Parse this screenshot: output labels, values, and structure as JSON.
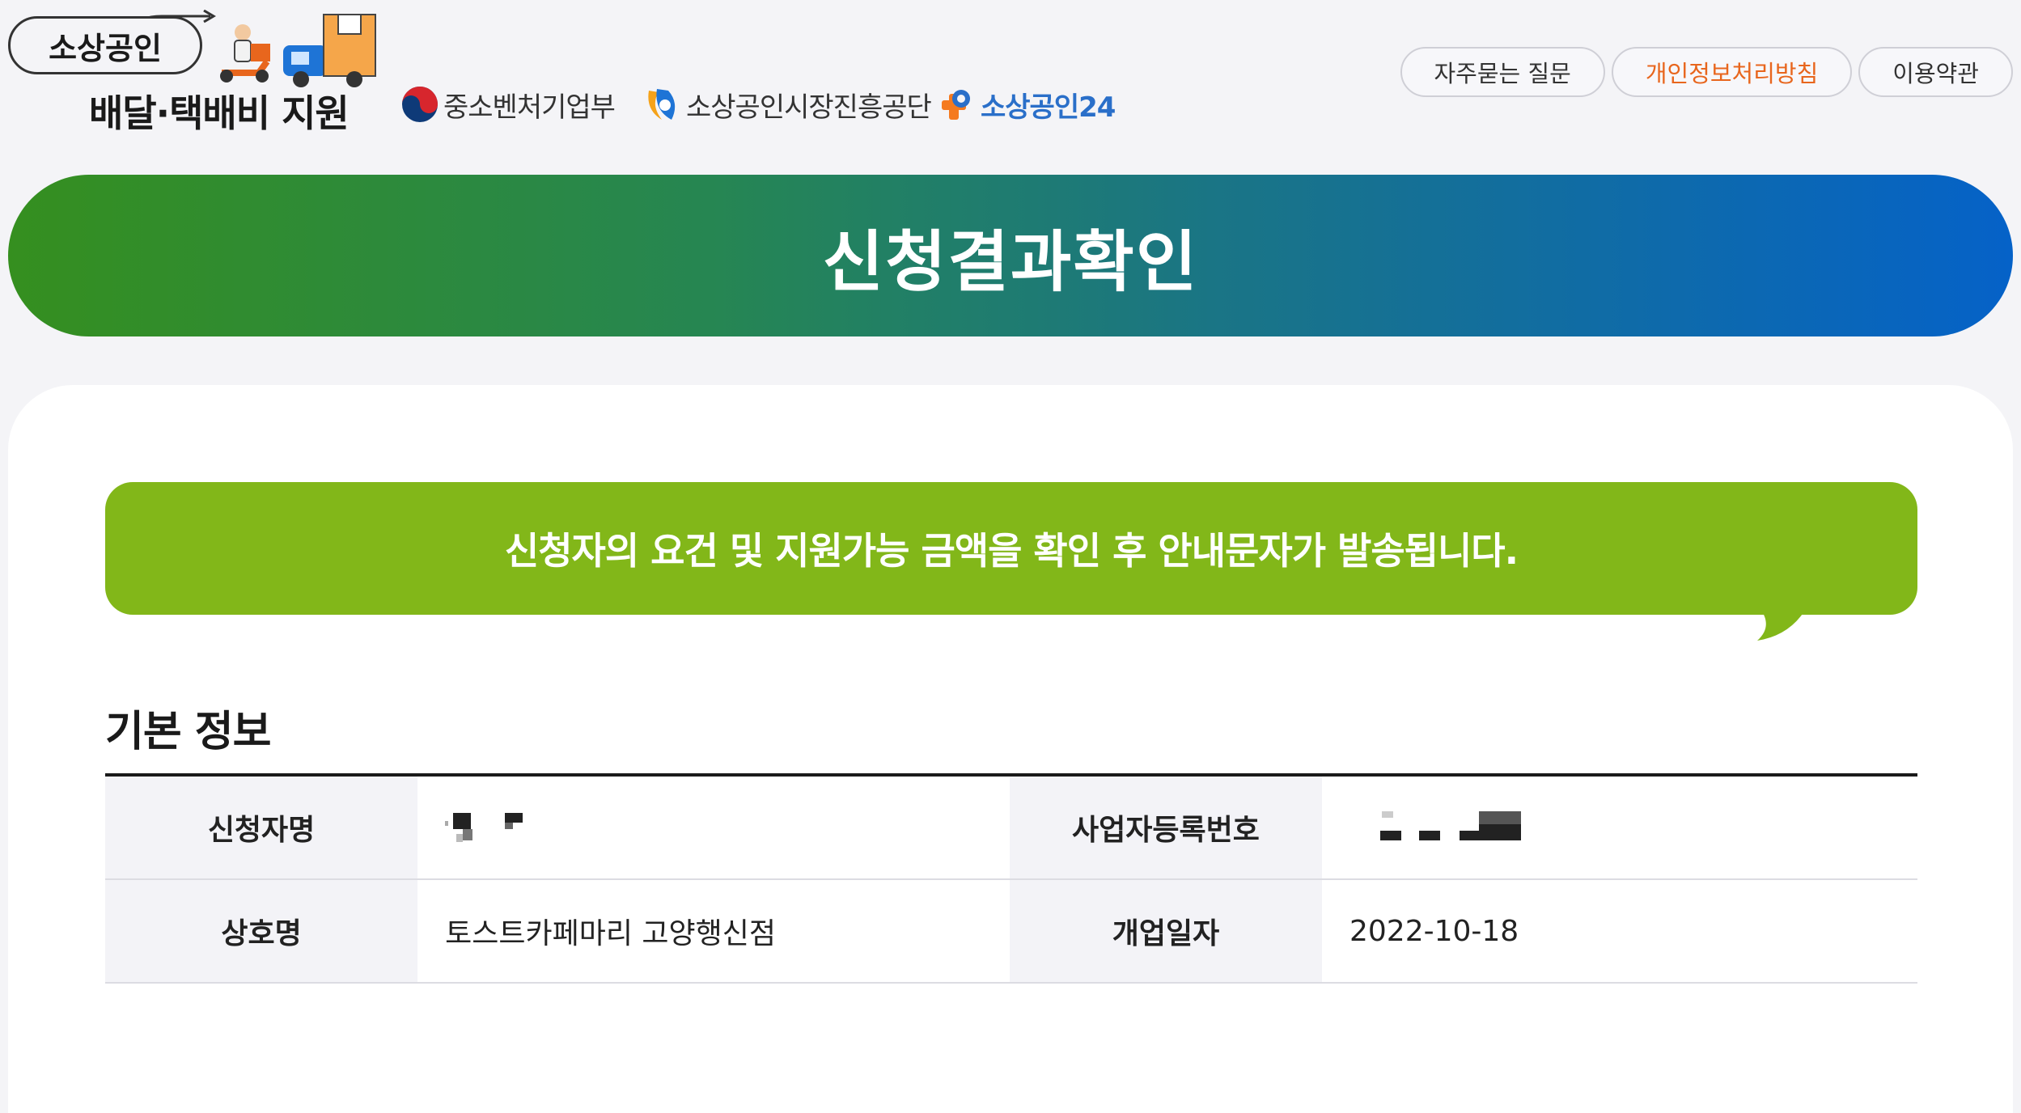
{
  "logo": {
    "top_text": "소상공인",
    "bottom_text": "배달·택배비 지원"
  },
  "partners": [
    {
      "name": "중소벤처기업부",
      "icon": "taegeuk-icon"
    },
    {
      "name": "소상공인시장진흥공단",
      "icon": "semas-icon"
    },
    {
      "name": "소상공인24",
      "icon": "plus-p-icon"
    }
  ],
  "nav": {
    "faq": "자주묻는 질문",
    "privacy": "개인정보처리방침",
    "terms": "이용약관"
  },
  "banner": {
    "title": "신청결과확인"
  },
  "notice": {
    "text": "신청자의 요건 및 지원가능 금액을 확인 후 안내문자가 발송됩니다."
  },
  "basic_info": {
    "title": "기본 정보",
    "applicant_label": "신청자명",
    "business_no_label": "사업자등록번호",
    "shop_name_label": "상호명",
    "shop_name": "토스트카페마리 고양행신점",
    "open_date_label": "개업일자",
    "open_date": "2022-10-18"
  },
  "colors": {
    "active_nav": "#e8661d",
    "notice_bg": "#82b719",
    "banner_start": "#358f1f",
    "banner_end": "#0562c8"
  }
}
